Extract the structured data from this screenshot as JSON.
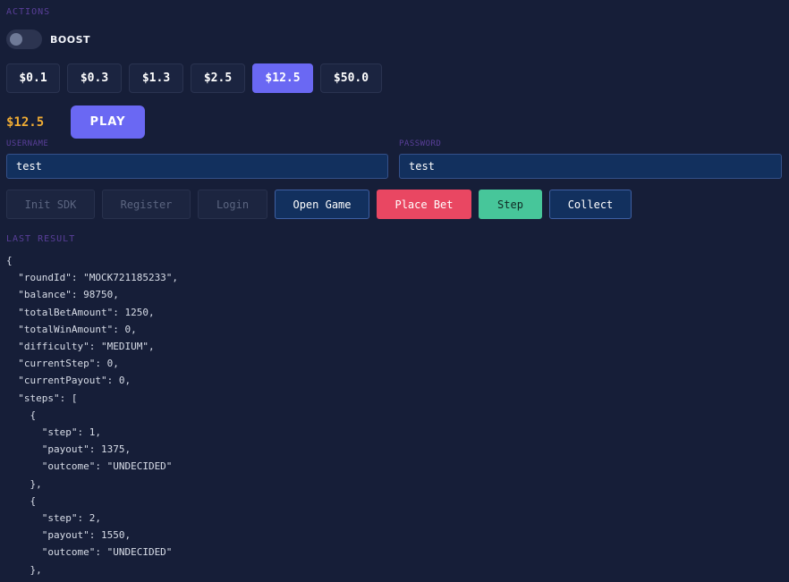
{
  "actions": {
    "section_label": "ACTIONS",
    "boost": {
      "label": "BOOST",
      "enabled": false
    },
    "bets": [
      {
        "label": "$0.1",
        "active": false
      },
      {
        "label": "$0.3",
        "active": false
      },
      {
        "label": "$1.3",
        "active": false
      },
      {
        "label": "$2.5",
        "active": false
      },
      {
        "label": "$12.5",
        "active": true
      },
      {
        "label": "$50.0",
        "active": false
      }
    ],
    "amount": "$12.5",
    "play_label": "PLAY"
  },
  "auth": {
    "username_label": "USERNAME",
    "username_value": "test",
    "password_label": "PASSWORD",
    "password_value": "test"
  },
  "controls": [
    {
      "label": "Init SDK",
      "state": "disabled"
    },
    {
      "label": "Register",
      "state": "disabled"
    },
    {
      "label": "Login",
      "state": "disabled"
    },
    {
      "label": "Open Game",
      "state": "navy"
    },
    {
      "label": "Place Bet",
      "state": "danger"
    },
    {
      "label": "Step",
      "state": "success"
    },
    {
      "label": "Collect",
      "state": "navy"
    }
  ],
  "result": {
    "section_label": "LAST RESULT",
    "lines": [
      "{",
      "  \"roundId\": \"MOCK721185233\",",
      "  \"balance\": 98750,",
      "  \"totalBetAmount\": 1250,",
      "  \"totalWinAmount\": 0,",
      "  \"difficulty\": \"MEDIUM\",",
      "  \"currentStep\": 0,",
      "  \"currentPayout\": 0,",
      "  \"steps\": [",
      "    {",
      "      \"step\": 1,",
      "      \"payout\": 1375,",
      "      \"outcome\": \"UNDECIDED\"",
      "    },",
      "    {",
      "      \"step\": 2,",
      "      \"payout\": 1550,",
      "      \"outcome\": \"UNDECIDED\"",
      "    },"
    ]
  },
  "colors": {
    "background": "#161e38",
    "accent": "#6a68f3",
    "amount": "#f0ac34",
    "danger": "#e94762",
    "success": "#47c69a",
    "navy": "#12305e",
    "label": "#5a3f9a"
  }
}
